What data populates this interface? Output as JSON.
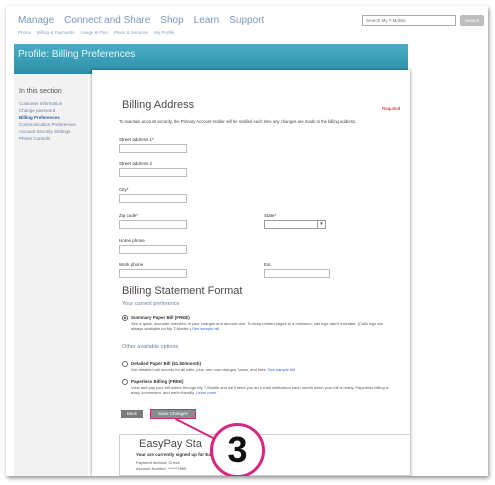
{
  "top_nav": [
    "Manage",
    "Connect and Share",
    "Shop",
    "Learn",
    "Support"
  ],
  "sub_nav": [
    "Phone",
    "Billing & Payments",
    "Usage & Plan",
    "Plans & Services",
    "My Profile"
  ],
  "search": {
    "placeholder": "Search My T-Mobile",
    "button": "Search"
  },
  "page_title": "Profile: Billing Preferences",
  "sidebar": {
    "heading": "In this section",
    "items": [
      {
        "label": "Customer Information"
      },
      {
        "label": "Change password"
      },
      {
        "label": "Billing Preferences"
      },
      {
        "label": "Communication Preferences"
      },
      {
        "label": "Account Security Settings"
      },
      {
        "label": "Phone Controls"
      }
    ]
  },
  "billing_address": {
    "title": "Billing Address",
    "required": "Required",
    "intro": "To maintain account security, the Primary Account Holder will be notified each time any changes are made to the billing address.",
    "fields": {
      "street1": "Street address 1*",
      "street2": "Street address 2",
      "city": "City*",
      "zip": "Zip code*",
      "state": "State*",
      "home_phone": "Home phone",
      "work_phone": "Work phone",
      "ext": "Ext."
    }
  },
  "statement": {
    "title": "Billing Statement Format",
    "current_label": "Your current preference",
    "current_option": {
      "title": "Summary Paper Bill (FREE)",
      "desc": "See a quick, accurate overview of your charges and amount due. To keep printed pages to a minimum, call logs aren't included. (Calls logs are always available on My T-Mobile.)",
      "link": "See sample bill"
    },
    "other_label": "Other available options",
    "options": [
      {
        "title": "Detailed Paper Bill ($1.50/month)",
        "desc": "Get detailed call records for all calls, plus, see how charges, taxes, and fees.",
        "link": "See sample bill"
      },
      {
        "title": "Paperless Billing (FREE)",
        "desc": "View and pay your bill online through My T-Mobile and we'll send you an e-mail notification each month when your bill is ready. Paperless billing is easy, convenient, and earth-friendly.",
        "link": "Learn more"
      }
    ]
  },
  "buttons": {
    "back": "Back",
    "save": "Save Changes"
  },
  "callout": "3",
  "easypay": {
    "title": "EasyPay Sta",
    "desc": "Your are currently signed up for EasyPay",
    "line1": "Payment method: Check",
    "line2": "Account Number: ******7895"
  }
}
